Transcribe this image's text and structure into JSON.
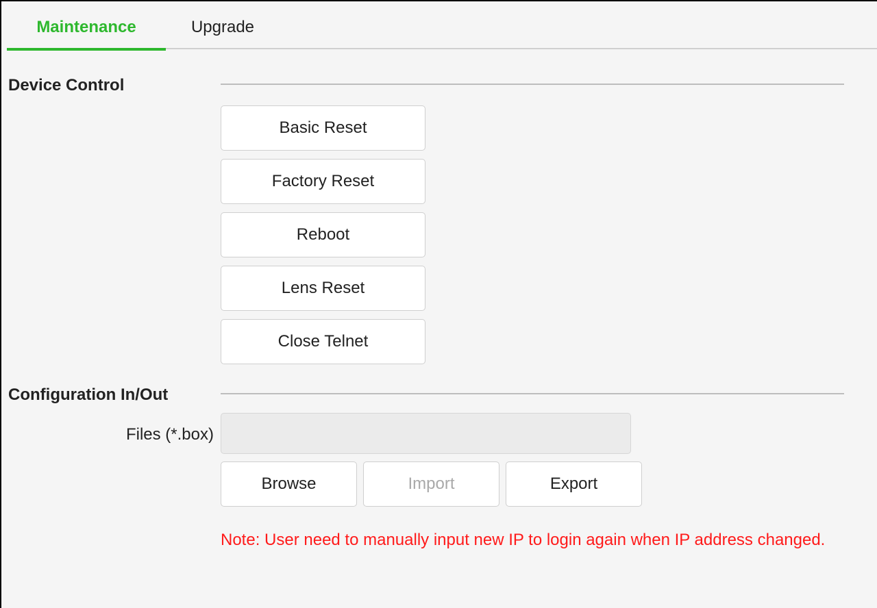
{
  "tabs": {
    "maintenance": "Maintenance",
    "upgrade": "Upgrade"
  },
  "device_control": {
    "title": "Device Control",
    "buttons": {
      "basic_reset": "Basic Reset",
      "factory_reset": "Factory Reset",
      "reboot": "Reboot",
      "lens_reset": "Lens Reset",
      "close_telnet": "Close Telnet"
    }
  },
  "config": {
    "title": "Configuration In/Out",
    "files_label": "Files (*.box)",
    "files_value": "",
    "browse": "Browse",
    "import": "Import",
    "export": "Export",
    "note": "Note: User need to manually input new IP to login again when IP address changed."
  },
  "colors": {
    "accent": "#2eb82e",
    "note": "#ff1a1a",
    "background": "#f5f5f5"
  }
}
